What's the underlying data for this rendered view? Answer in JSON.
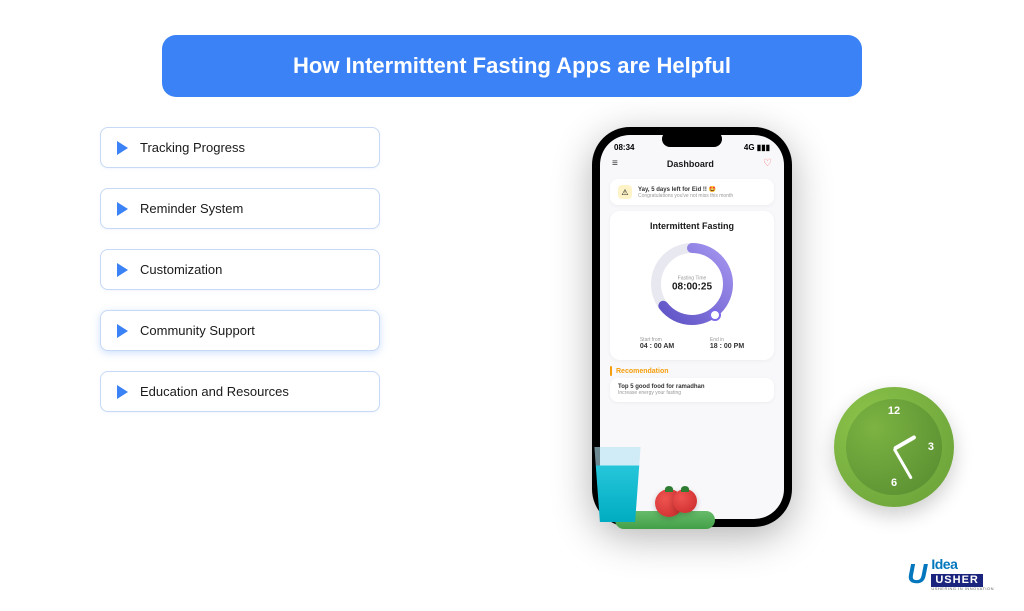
{
  "header": {
    "title": "How Intermittent Fasting Apps are Helpful"
  },
  "features": [
    {
      "label": "Tracking Progress"
    },
    {
      "label": "Reminder System"
    },
    {
      "label": "Customization"
    },
    {
      "label": "Community Support"
    },
    {
      "label": "Education and Resources"
    }
  ],
  "phone": {
    "status": {
      "time": "08:34",
      "signal": "4G"
    },
    "dashboard_label": "Dashboard",
    "notification": {
      "title": "Yay, 5 days left for Eid !! 🤩",
      "subtitle": "Congratulations you've not miss this month"
    },
    "fasting": {
      "title": "Intermittent Fasting",
      "ring_label": "Fasting Time",
      "ring_time": "08:00:25",
      "start_label": "Start from",
      "start_value": "04 : 00 AM",
      "end_label": "End in",
      "end_value": "18 : 00 PM"
    },
    "recommendation": {
      "header": "Recomendation",
      "title": "Top 5 good food for ramadhan",
      "subtitle": "Increase energy your fasting"
    }
  },
  "clock": {
    "n12": "12",
    "n3": "3",
    "n6": "6"
  },
  "logo": {
    "main": "Idea",
    "box": "USHER",
    "tag": "USHERING IN INNOVATION"
  }
}
